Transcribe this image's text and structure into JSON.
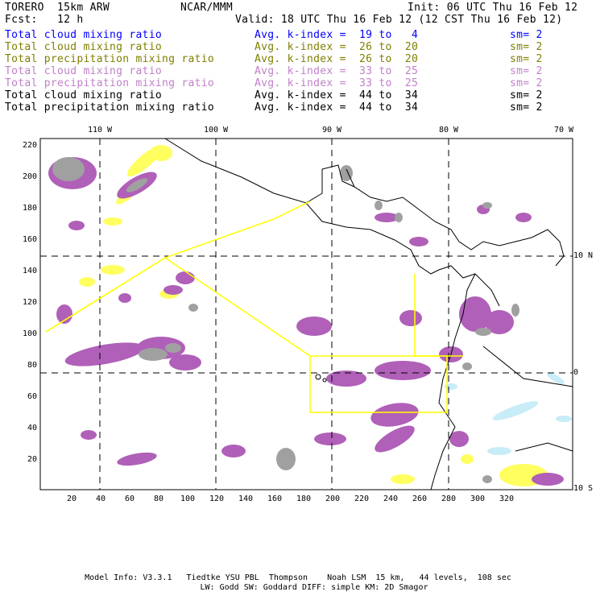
{
  "header": {
    "title": "TORERO  15km ARW",
    "org": "NCAR/MMM",
    "init": "Init: 06 UTC Thu 16 Feb 12",
    "fcst": "Fcst:   12 h",
    "valid": "Valid: 18 UTC Thu 16 Feb 12 (12 CST Thu 16 Feb 12)"
  },
  "legend": [
    {
      "field": "Total cloud mixing ratio",
      "range": "Avg. k-index =  19 to   4",
      "sm": "sm= 2",
      "color": "#0000ff"
    },
    {
      "field": "Total cloud mixing ratio",
      "range": "Avg. k-index =  26 to  20",
      "sm": "sm= 2",
      "color": "#7f7f00"
    },
    {
      "field": "Total precipitation mixing ratio",
      "range": "Avg. k-index =  26 to  20",
      "sm": "sm= 2",
      "color": "#7f7f00"
    },
    {
      "field": "Total cloud mixing ratio",
      "range": "Avg. k-index =  33 to  25",
      "sm": "sm= 2",
      "color": "#c080c8"
    },
    {
      "field": "Total precipitation mixing ratio",
      "range": "Avg. k-index =  33 to  25",
      "sm": "sm= 2",
      "color": "#c080c8"
    },
    {
      "field": "Total cloud mixing ratio",
      "range": "Avg. k-index =  44 to  34",
      "sm": "sm= 2",
      "color": "#000000"
    },
    {
      "field": "Total precipitation mixing ratio",
      "range": "Avg. k-index =  44 to  34",
      "sm": "sm= 2",
      "color": "#000000"
    }
  ],
  "map": {
    "lon_labels": [
      "110 W",
      "100 W",
      "90 W",
      "80 W",
      "70 W"
    ],
    "lat_labels": [
      "10 N",
      "0",
      "10 S"
    ],
    "x_ticks": [
      "20",
      "40",
      "60",
      "80",
      "100",
      "120",
      "140",
      "160",
      "180",
      "200",
      "220",
      "240",
      "260",
      "280",
      "300",
      "320"
    ],
    "y_ticks": [
      "220",
      "200",
      "180",
      "160",
      "140",
      "120",
      "100",
      "80",
      "60",
      "40",
      "20"
    ],
    "colors": {
      "light": "#ffff60",
      "mid": "#b060b8",
      "heavy": "#a0a0a0",
      "ice": "#c8ecf8",
      "boundary": "#ffff00"
    }
  },
  "footer": {
    "line1": "Model Info: V3.3.1   Tiedtke YSU PBL  Thompson    Noah LSM  15 km,   44 levels,  108 sec",
    "line2": "LW: Godd SW: Goddard DIFF: simple KM: 2D Smagor"
  }
}
